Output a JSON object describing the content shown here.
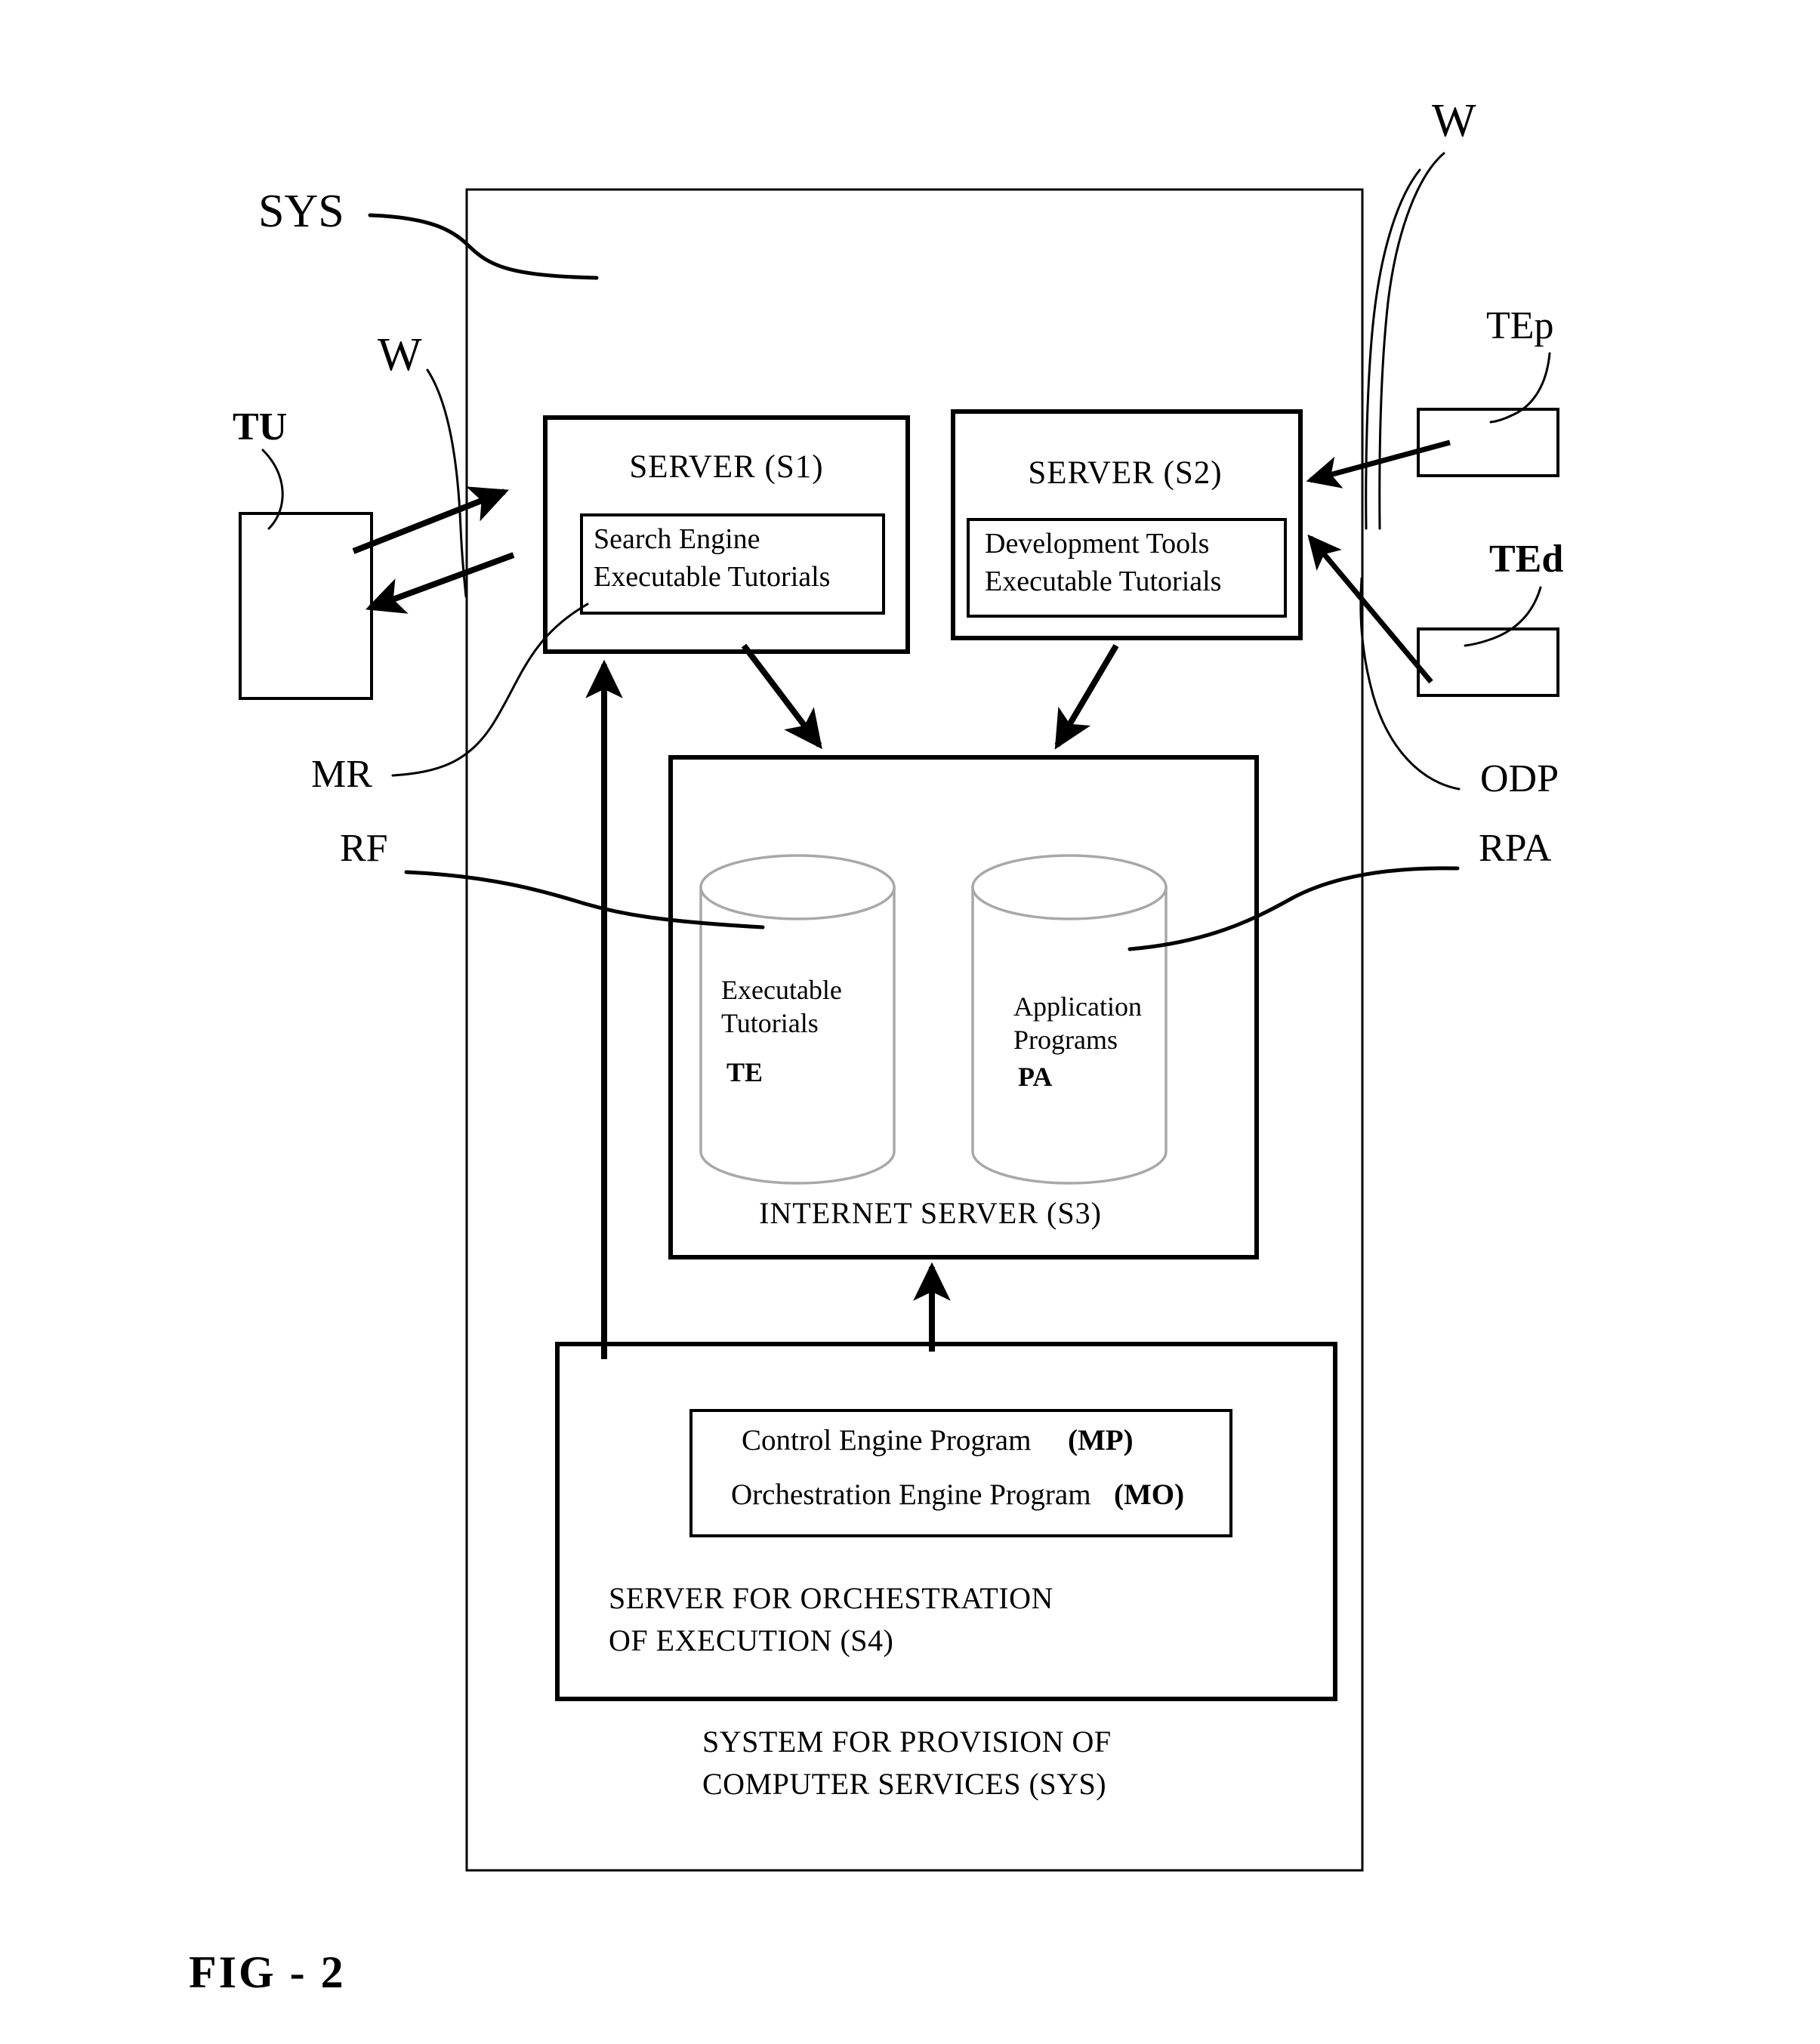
{
  "figure": {
    "caption": "FIG - 2",
    "outer_label": "SYS",
    "system_name_line1": "SYSTEM FOR PROVISION OF",
    "system_name_line2": "COMPUTER SERVICES (SYS)"
  },
  "reference_labels": {
    "sys": "SYS",
    "w_left": "W",
    "w_right": "W",
    "tu": "TU",
    "mr": "MR",
    "rf": "RF",
    "rpa": "RPA",
    "tep": "TEp",
    "ted": "TEd",
    "odp": "ODP"
  },
  "servers": {
    "s1": {
      "title": "SERVER  (S1)",
      "inner_line1": "Search Engine",
      "inner_line2": "Executable Tutorials"
    },
    "s2": {
      "title": "SERVER  (S2)",
      "inner_line1": "Development Tools",
      "inner_line2": "Executable Tutorials"
    },
    "s3": {
      "title": "INTERNET SERVER (S3)",
      "store_te": {
        "line1": "Executable",
        "line2": "Tutorials",
        "code": "TE"
      },
      "store_pa": {
        "line1": "Application",
        "line2": "Programs",
        "code": "PA"
      }
    },
    "s4": {
      "title_line1": "SERVER FOR ORCHESTRATION",
      "title_line2": " OF EXECUTION  (S4)",
      "program_mp_name": "Control Engine Program",
      "program_mp_code": "(MP)",
      "program_mo_name": "Orchestration Engine Program",
      "program_mo_code": "(MO)"
    }
  },
  "colors": {
    "stroke": "#000000",
    "cylinder_stroke": "#a8a8a8",
    "background": "#ffffff"
  }
}
